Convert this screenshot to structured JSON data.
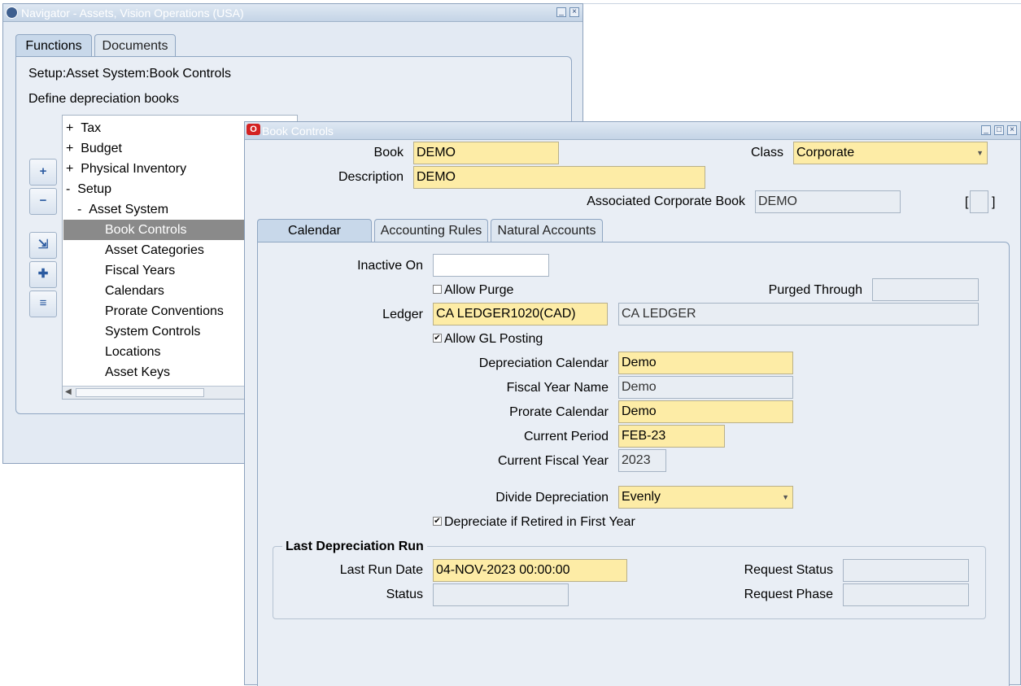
{
  "navigator": {
    "title": "Navigator - Assets, Vision Operations (USA)",
    "tabs": [
      "Functions",
      "Documents"
    ],
    "path": "Setup:Asset System:Book Controls",
    "description": "Define depreciation books",
    "tree": [
      {
        "prefix": "+",
        "label": "Tax"
      },
      {
        "prefix": "+",
        "label": "Budget"
      },
      {
        "prefix": "+",
        "label": "Physical Inventory"
      },
      {
        "prefix": "-",
        "label": "Setup"
      },
      {
        "prefix": "-",
        "label": "Asset System"
      },
      {
        "prefix": "",
        "label": "Book Controls"
      },
      {
        "prefix": "",
        "label": "Asset Categories"
      },
      {
        "prefix": "",
        "label": "Fiscal Years"
      },
      {
        "prefix": "",
        "label": "Calendars"
      },
      {
        "prefix": "",
        "label": "Prorate Conventions"
      },
      {
        "prefix": "",
        "label": "System Controls"
      },
      {
        "prefix": "",
        "label": "Locations"
      },
      {
        "prefix": "",
        "label": "Asset Keys"
      }
    ]
  },
  "book_controls": {
    "title": "Book Controls",
    "header": {
      "book_label": "Book",
      "book_value": "DEMO",
      "class_label": "Class",
      "class_value": "Corporate",
      "description_label": "Description",
      "description_value": "DEMO",
      "assoc_label": "Associated Corporate Book",
      "assoc_value": "DEMO",
      "bracket_open": "[",
      "bracket_close": "]"
    },
    "tabs": [
      "Calendar",
      "Accounting Rules",
      "Natural Accounts"
    ],
    "calendar": {
      "inactive_on_label": "Inactive On",
      "inactive_on_value": "",
      "allow_purge_label": "Allow Purge",
      "purged_through_label": "Purged Through",
      "purged_through_value": "",
      "ledger_label": "Ledger",
      "ledger_value": "CA LEDGER1020(CAD)",
      "ledger_name": "CA LEDGER",
      "allow_gl_label": "Allow GL Posting",
      "dep_calendar_label": "Depreciation Calendar",
      "dep_calendar_value": "Demo",
      "fiscal_year_name_label": "Fiscal Year Name",
      "fiscal_year_name_value": "Demo",
      "prorate_calendar_label": "Prorate Calendar",
      "prorate_calendar_value": "Demo",
      "current_period_label": "Current Period",
      "current_period_value": "FEB-23",
      "current_fy_label": "Current Fiscal Year",
      "current_fy_value": "2023",
      "divide_dep_label": "Divide Depreciation",
      "divide_dep_value": "Evenly",
      "dep_retired_label": "Depreciate if Retired in First Year"
    },
    "last_run": {
      "section_title": "Last Depreciation Run",
      "last_run_date_label": "Last Run Date",
      "last_run_date_value": "04-NOV-2023 00:00:00",
      "status_label": "Status",
      "status_value": "",
      "request_status_label": "Request Status",
      "request_status_value": "",
      "request_phase_label": "Request Phase",
      "request_phase_value": ""
    }
  },
  "checkboxes": {
    "allow_purge": false,
    "allow_gl_posting": true,
    "dep_retired": true
  },
  "colors": {
    "required_field": "#fdeca6",
    "window_bg": "#e9eef5",
    "selected_tree": "#8a8a8a"
  }
}
